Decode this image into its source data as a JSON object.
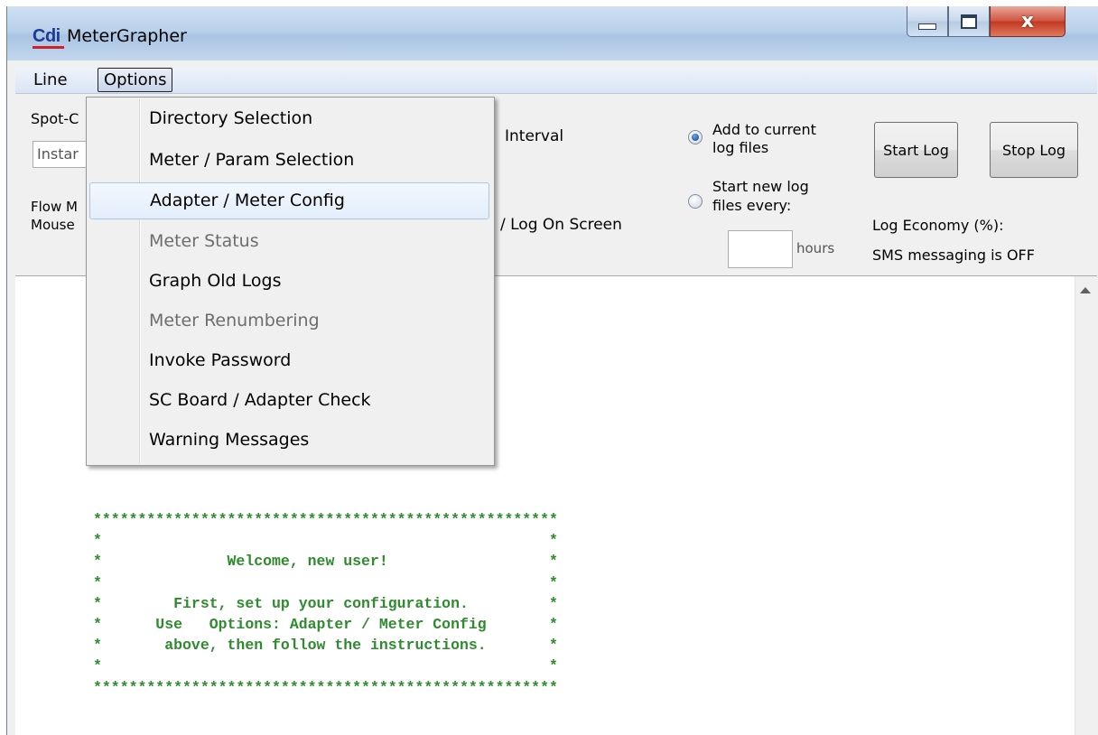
{
  "window": {
    "title": "MeterGrapher",
    "logo_text": "Cdi",
    "controls": {
      "minimize": "minimize",
      "maximize": "maximize",
      "close": "x"
    }
  },
  "menubar": {
    "items": [
      {
        "label": "Line"
      },
      {
        "label": "Options"
      }
    ]
  },
  "toolbar": {
    "spot_label": "Spot-C",
    "spot_combo_value": "Instar",
    "flow_label": "Flow M",
    "mouse_label": "Mouse",
    "interval_label": "Interval",
    "log_on_screen": "/ Log On Screen",
    "radio_add": {
      "line1": "Add to current",
      "line2": "log files",
      "checked": true
    },
    "radio_new": {
      "line1": "Start new log",
      "line2": "files every:",
      "checked": false
    },
    "hours_label": "hours",
    "start_log": "Start Log",
    "stop_log": "Stop Log",
    "log_economy": "Log Economy (%):",
    "sms_status": "SMS messaging is OFF"
  },
  "options_menu": {
    "items": [
      {
        "label": "Directory Selection",
        "enabled": true
      },
      {
        "label": "Meter / Param Selection",
        "enabled": true
      },
      {
        "label": "Adapter / Meter Config",
        "enabled": true,
        "highlighted": true
      },
      {
        "label": "Meter Status",
        "enabled": false
      },
      {
        "label": "Graph Old Logs",
        "enabled": true
      },
      {
        "label": "Meter Renumbering",
        "enabled": false
      },
      {
        "label": "Invoke Password",
        "enabled": true
      },
      {
        "label": "SC Board / Adapter Check",
        "enabled": true
      },
      {
        "label": "Warning Messages",
        "enabled": true
      }
    ]
  },
  "content": {
    "welcome_text": "****************************************************\n*                                                  *\n*              Welcome, new user!                  *\n*                                                  *\n*        First, set up your configuration.         *\n*      Use   Options: Adapter / Meter Config       *\n*       above, then follow the instructions.       *\n*                                                  *\n****************************************************",
    "text_color": "#2e8b2e"
  },
  "colors": {
    "title_bar": "#b9d1ea",
    "close_button": "#c2371f",
    "menu_highlight": "#e3eefb"
  }
}
